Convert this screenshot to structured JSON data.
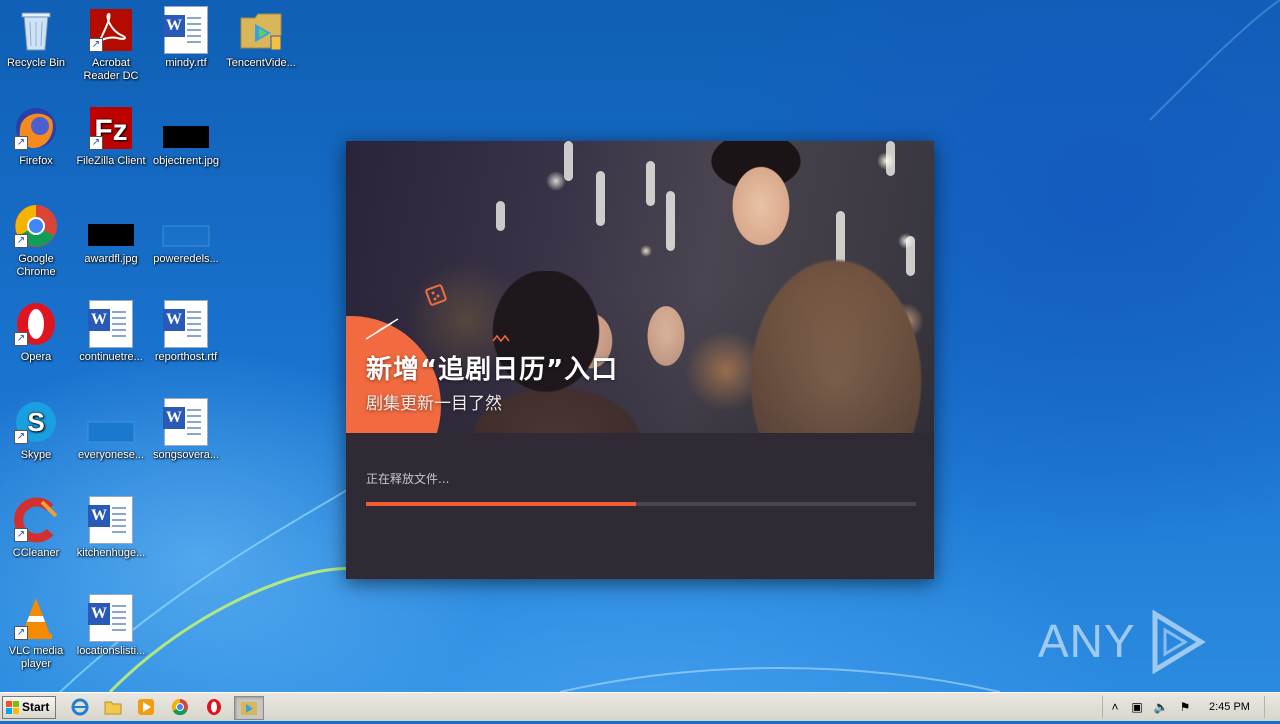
{
  "desktop": {
    "icons": [
      {
        "label": "Recycle Bin",
        "icon": "recycle-bin-icon"
      },
      {
        "label": "Acrobat Reader DC",
        "icon": "acrobat-reader-icon"
      },
      {
        "label": "mindy.rtf",
        "icon": "word-document-icon"
      },
      {
        "label": "TencentVide...",
        "icon": "tencent-video-icon"
      },
      {
        "label": "Firefox",
        "icon": "firefox-icon"
      },
      {
        "label": "FileZilla Client",
        "icon": "filezilla-icon"
      },
      {
        "label": "objectrent.jpg",
        "icon": "image-file-icon"
      },
      {
        "label": "Google Chrome",
        "icon": "chrome-icon"
      },
      {
        "label": "awardfl.jpg",
        "icon": "image-file-icon"
      },
      {
        "label": "poweredels...",
        "icon": "blank-file-icon"
      },
      {
        "label": "Opera",
        "icon": "opera-icon"
      },
      {
        "label": "continuetre...",
        "icon": "word-document-icon"
      },
      {
        "label": "reporthost.rtf",
        "icon": "word-document-icon"
      },
      {
        "label": "Skype",
        "icon": "skype-icon"
      },
      {
        "label": "everyonese...",
        "icon": "blank-file-icon"
      },
      {
        "label": "songsovera...",
        "icon": "word-document-icon"
      },
      {
        "label": "CCleaner",
        "icon": "ccleaner-icon"
      },
      {
        "label": "kitchenhuge...",
        "icon": "word-document-icon"
      },
      {
        "label": "VLC media player",
        "icon": "vlc-icon"
      },
      {
        "label": "locationslisti...",
        "icon": "word-document-icon"
      }
    ]
  },
  "installer": {
    "banner_title": "新增“追剧日历”入口",
    "banner_subtitle": "剧集更新一目了然",
    "status_text": "正在释放文件...",
    "progress_fraction": 0.49,
    "accent_color": "#f25a33"
  },
  "watermark": {
    "text_left": "ANY",
    "text_right": "RUN"
  },
  "taskbar": {
    "start_label": "Start",
    "pinned": [
      "internet-explorer-icon",
      "file-explorer-icon",
      "media-player-icon",
      "chrome-icon",
      "opera-icon",
      "tencent-video-icon"
    ],
    "clock": "2:45 PM"
  }
}
